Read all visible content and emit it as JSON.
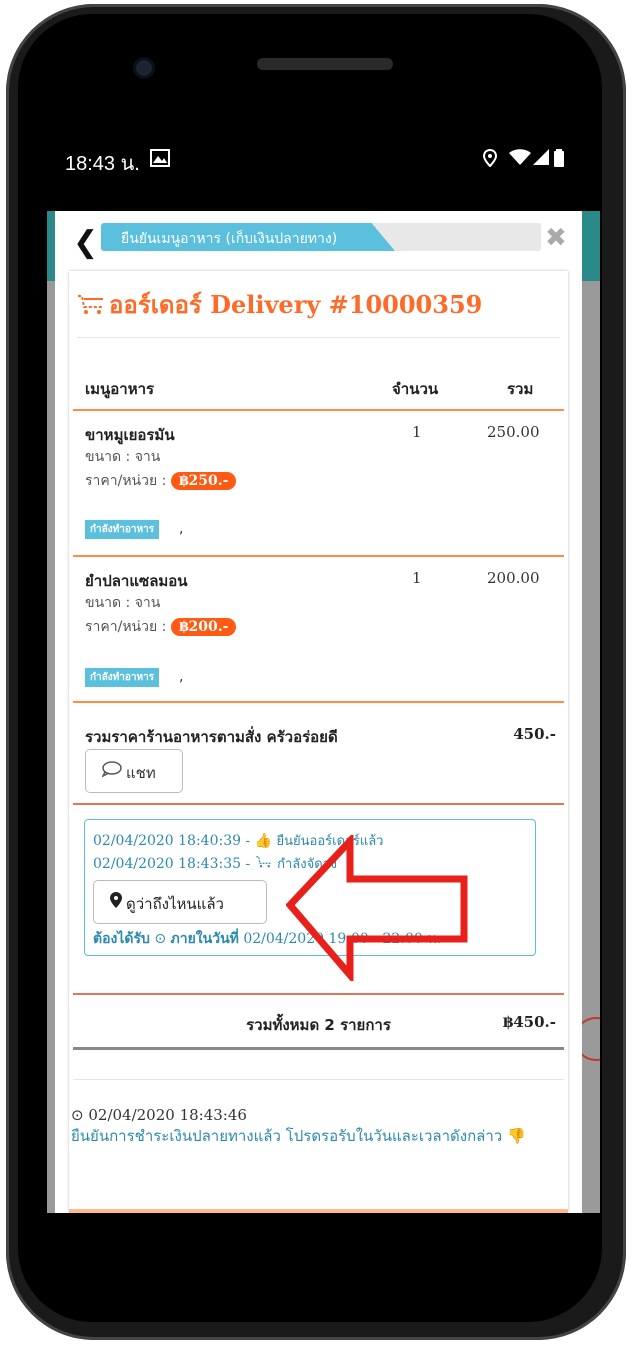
{
  "status_bar": {
    "time": "18:43 น.",
    "mail_icon": "image-icon",
    "location_icon": "location-icon",
    "wifi_icon": "wifi-icon",
    "signal_icon": "signal-icon",
    "battery_icon": "battery-icon"
  },
  "top_bar": {
    "back_icon": "chevron-left-icon",
    "step_label": "ยืนยันเมนูอาหาร (เก็บเงินปลายทาง)",
    "close_icon": "close-icon"
  },
  "order": {
    "title": "ออร์เดอร์ Delivery #10000359",
    "columns": [
      "เมนูอาหาร",
      "จำนวน",
      "รวม"
    ],
    "items": [
      {
        "name": "ขาหมูเยอรมัน",
        "size_label": "ขนาด : จาน",
        "unit_price_label": "ราคา/หน่วย :",
        "unit_price": "฿250.-",
        "qty": "1",
        "total": "250.00",
        "status": "กำลังทำอาหาร",
        "status_suffix": ","
      },
      {
        "name": "ยำปลาแซลมอน",
        "size_label": "ขนาด : จาน",
        "unit_price_label": "ราคา/หน่วย :",
        "unit_price": "฿200.-",
        "qty": "1",
        "total": "200.00",
        "status": "กำลังทำอาหาร",
        "status_suffix": ","
      }
    ],
    "restaurant_summary": "รวมราคาร้านอาหารตามสั่ง ครัวอร่อยดี",
    "restaurant_total": "450.-",
    "chat_button": "แชท"
  },
  "timeline": {
    "line1_time": "02/04/2020 18:40:39 -",
    "line1_text": "ยืนยันออร์เดอร์แล้ว",
    "line2_time": "02/04/2020 18:43:35 -",
    "line2_text": "กำลังจัดส่ง",
    "track_button": "ดูว่าถึงไหนแล้ว",
    "deliver_label": "ต้องได้รับ",
    "deliver_within": "ภายในวันที่",
    "deliver_time": "02/04/2020 19:00 - 22:00 น."
  },
  "summary": {
    "label": "รวมทั้งหมด 2 รายการ",
    "total": "฿450.-"
  },
  "payment": {
    "time": "02/04/2020 18:43:46",
    "message": "ยืนยันการชำระเงินปลายทางแล้ว โปรดรอรับในวันและเวลาดังกล่าว"
  },
  "colors": {
    "accent_orange": "#ff6a28",
    "info_blue": "#5bc0de",
    "teal_text": "#2a8aad",
    "arrow_red": "#e8201a"
  }
}
